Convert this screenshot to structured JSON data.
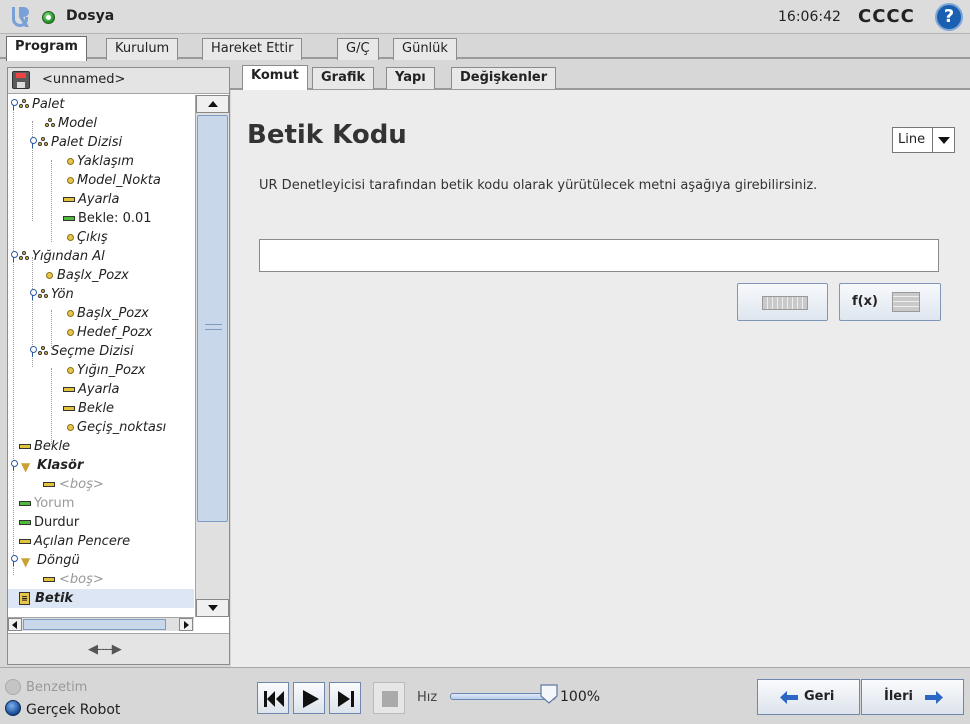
{
  "titlebar": {
    "title": "Dosya",
    "time": "16:06:42",
    "robot_name": "CCCC",
    "help_glyph": "?",
    "status_color": "#2a9a2a"
  },
  "main_tabs": [
    {
      "label": "Program",
      "active": true
    },
    {
      "label": "Kurulum",
      "active": false
    },
    {
      "label": "Hareket Ettir",
      "active": false
    },
    {
      "label": "G/Ç",
      "active": false
    },
    {
      "label": "Günlük",
      "active": false
    }
  ],
  "program": {
    "name": "<unnamed>"
  },
  "tree": [
    {
      "label": "Palet",
      "icon": "pallet-icon"
    },
    {
      "label": "Model",
      "icon": "pallet-icon"
    },
    {
      "label": "Palet Dizisi",
      "icon": "pallet-icon"
    },
    {
      "label": "Yaklaşım",
      "icon": "waypoint-icon"
    },
    {
      "label": "Model_Nokta",
      "icon": "waypoint-icon"
    },
    {
      "label": "Ayarla",
      "icon": "set-icon"
    },
    {
      "label": "Bekle: 0.01",
      "icon": "wait-icon"
    },
    {
      "label": "Çıkış",
      "icon": "waypoint-icon"
    },
    {
      "label": "Yığından Al",
      "icon": "pallet-icon"
    },
    {
      "label": "Başlx_Pozx",
      "icon": "waypoint-icon"
    },
    {
      "label": "Yön",
      "icon": "pallet-icon"
    },
    {
      "label": "Başlx_Pozx",
      "icon": "waypoint-icon"
    },
    {
      "label": "Hedef_Pozx",
      "icon": "waypoint-icon"
    },
    {
      "label": "Seçme Dizisi",
      "icon": "pallet-icon"
    },
    {
      "label": "Yığın_Pozx",
      "icon": "waypoint-icon"
    },
    {
      "label": "Ayarla",
      "icon": "set-icon"
    },
    {
      "label": "Bekle",
      "icon": "set-icon"
    },
    {
      "label": "Geçiş_noktası",
      "icon": "waypoint-icon"
    },
    {
      "label": "Bekle",
      "icon": "set-icon"
    },
    {
      "label": "Klasör",
      "icon": "folder-icon"
    },
    {
      "label": "<boş>",
      "icon": "set-icon"
    },
    {
      "label": "Yorum",
      "icon": "comment-icon"
    },
    {
      "label": "Durdur",
      "icon": "halt-icon"
    },
    {
      "label": "Açılan Pencere",
      "icon": "popup-icon"
    },
    {
      "label": "Döngü",
      "icon": "loop-icon"
    },
    {
      "label": "<boş>",
      "icon": "set-icon"
    },
    {
      "label": "Betik",
      "icon": "script-icon",
      "selected": true
    }
  ],
  "sub_tabs": [
    {
      "label": "Komut",
      "active": true
    },
    {
      "label": "Grafik",
      "active": false
    },
    {
      "label": "Yapı",
      "active": false
    },
    {
      "label": "Değişkenler",
      "active": false
    }
  ],
  "script": {
    "title": "Betik Kodu",
    "mode": "Line",
    "description": "UR Denetleyicisi tarafından betik kodu olarak yürütülecek metni aşağıya girebilirsiniz.",
    "input_value": "",
    "fx_label": "f(x)"
  },
  "bottom": {
    "simulation_label": "Benzetim",
    "real_robot_label": "Gerçek Robot",
    "speed_label": "Hız",
    "speed_value": "100%",
    "speed_fraction": 1.0,
    "back_label": "Geri",
    "next_label": "İleri"
  }
}
